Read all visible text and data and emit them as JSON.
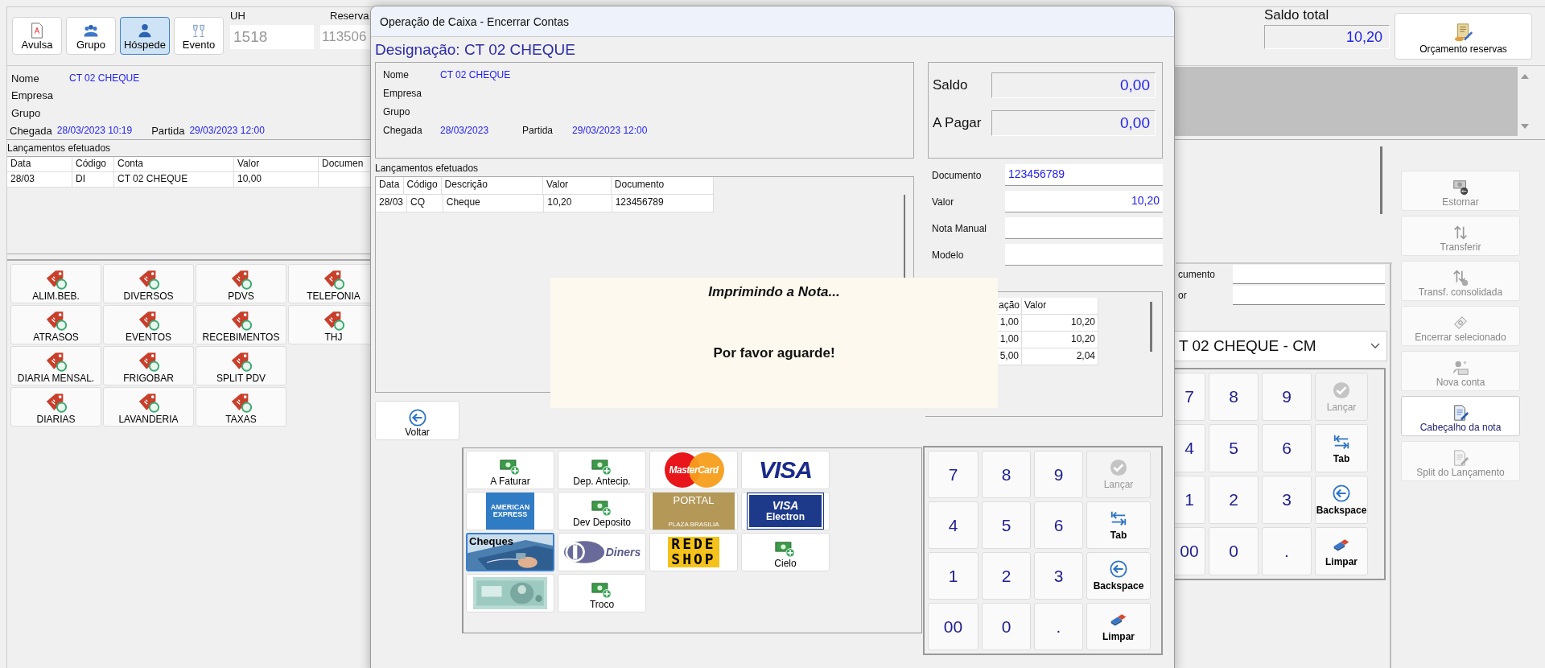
{
  "app": {
    "toolbar": [
      {
        "label": "Avulsa",
        "selected": false
      },
      {
        "label": "Grupo",
        "selected": false
      },
      {
        "label": "Hóspede",
        "selected": true
      },
      {
        "label": "Evento",
        "selected": false
      }
    ],
    "uh": {
      "label": "UH",
      "value": "1518"
    },
    "reserva": {
      "label": "Reserva",
      "value": "113506"
    },
    "saldo_total": {
      "label": "Saldo total",
      "value": "10,20"
    },
    "orcamento_button": "Orçamento reservas",
    "guest": {
      "nome_label": "Nome",
      "nome": "CT 02 CHEQUE",
      "empresa_label": "Empresa",
      "grupo_label": "Grupo",
      "chegada_label": "Chegada",
      "chegada": "28/03/2023 10:19",
      "partida_label": "Partida",
      "partida": "29/03/2023 12:00"
    },
    "lancamentos": {
      "title": "Lançamentos efetuados",
      "columns": [
        "Data",
        "Código",
        "Conta",
        "Valor",
        "Documen"
      ],
      "rows": [
        [
          "28/03",
          "DI",
          "CT 02 CHEQUE",
          "10,00"
        ]
      ]
    },
    "categories": [
      [
        "ALIM.BEB.",
        "DIVERSOS",
        "PDVS",
        "TELEFONIA"
      ],
      [
        "ATRASOS",
        "EVENTOS",
        "RECEBIMENTOS",
        "THJ"
      ],
      [
        "DIARIA MENSAL.",
        "FRIGOBAR",
        "SPLIT PDV"
      ],
      [
        "DIARIAS",
        "LAVANDERIA",
        "TAXAS"
      ]
    ],
    "side_fields": [
      {
        "label": "cumento"
      },
      {
        "label": "or"
      }
    ],
    "account_select": "T 02 CHEQUE - CM",
    "keypad": [
      {
        "label": "7",
        "kind": "digit",
        "disabled": false
      },
      {
        "label": "8",
        "kind": "digit",
        "disabled": false
      },
      {
        "label": "9",
        "kind": "digit",
        "disabled": false
      },
      {
        "label": "Lançar",
        "kind": "enter",
        "disabled": true
      },
      {
        "label": "4",
        "kind": "digit",
        "disabled": false
      },
      {
        "label": "5",
        "kind": "digit",
        "disabled": false
      },
      {
        "label": "6",
        "kind": "digit",
        "disabled": false
      },
      {
        "label": "Tab",
        "kind": "tab",
        "disabled": false
      },
      {
        "label": "1",
        "kind": "digit",
        "disabled": false
      },
      {
        "label": "2",
        "kind": "digit",
        "disabled": false
      },
      {
        "label": "3",
        "kind": "digit",
        "disabled": false
      },
      {
        "label": "Backspace",
        "kind": "backspace",
        "disabled": false
      },
      {
        "label": "00",
        "kind": "digit",
        "disabled": false
      },
      {
        "label": "0",
        "kind": "digit",
        "disabled": false
      },
      {
        "label": ".",
        "kind": "digit",
        "disabled": false
      },
      {
        "label": "Limpar",
        "kind": "clear",
        "disabled": false
      }
    ],
    "actions": [
      {
        "label": "Estornar",
        "disabled": true
      },
      {
        "label": "Transferir",
        "disabled": true
      },
      {
        "label": "Transf. consolidada",
        "disabled": true
      },
      {
        "label": "Encerrar selecionado",
        "disabled": true
      },
      {
        "label": "Nova conta",
        "disabled": true
      },
      {
        "label": "Cabeçalho da nota",
        "disabled": false
      },
      {
        "label": "Split do Lançamento",
        "disabled": true
      }
    ]
  },
  "dialog": {
    "title": "Operação de Caixa - Encerrar Contas",
    "designacao": "Designação: CT 02 CHEQUE",
    "info": {
      "nome_label": "Nome",
      "nome": "CT 02 CHEQUE",
      "empresa_label": "Empresa",
      "grupo_label": "Grupo",
      "chegada_label": "Chegada",
      "chegada": "28/03/2023",
      "partida_label": "Partida",
      "partida": "29/03/2023 12:00"
    },
    "saldo": {
      "label": "Saldo",
      "value": "0,00"
    },
    "a_pagar": {
      "label": "A Pagar",
      "value": "0,00"
    },
    "lancamentos": {
      "title": "Lançamentos efetuados",
      "columns": [
        "Data",
        "Código",
        "Descrição",
        "Valor",
        "Documento"
      ],
      "rows": [
        [
          "28/03",
          "CQ",
          "Cheque",
          "10,20",
          "123456789"
        ]
      ]
    },
    "fields": [
      {
        "label": "Documento",
        "value": "123456789"
      },
      {
        "label": "Valor",
        "value": "10,20"
      },
      {
        "label": "Nota Manual"
      },
      {
        "label": "Modelo"
      }
    ],
    "small_table": {
      "columns": [
        "ação",
        "Valor"
      ],
      "rows": [
        [
          "1,00",
          "10,20"
        ],
        [
          "1,00",
          "10,20"
        ],
        [
          "5,00",
          "2,04"
        ]
      ]
    },
    "voltar": "Voltar",
    "payments": [
      {
        "kind": "cash",
        "label": "A Faturar",
        "selected": false
      },
      {
        "kind": "cash",
        "label": "Dep. Antecip.",
        "selected": false
      },
      {
        "kind": "mastercard",
        "text": [
          "MasterCard"
        ],
        "selected": false
      },
      {
        "kind": "visa",
        "text": [
          "VISA"
        ],
        "selected": false
      },
      {
        "kind": "amex",
        "text": [
          "AMERICAN",
          "EXPRESS"
        ],
        "selected": false
      },
      {
        "kind": "cash",
        "label": "Dev Deposito",
        "selected": false
      },
      {
        "kind": "portal",
        "text": [
          "PORTAL",
          "PLAZA BRASILIA"
        ],
        "selected": false
      },
      {
        "kind": "visa-electron",
        "text": [
          "VISA",
          "Electron"
        ],
        "selected": false
      },
      {
        "kind": "cheques",
        "label": "Cheques",
        "selected": true
      },
      {
        "kind": "diners",
        "text": [
          "Diners"
        ],
        "selected": false
      },
      {
        "kind": "redeshop",
        "text": [
          "REDE",
          "SHOP"
        ],
        "selected": false
      },
      {
        "kind": "cash",
        "label": "Cielo",
        "selected": false
      },
      {
        "kind": "banknote",
        "selected": false
      },
      {
        "kind": "cash",
        "label": "Troco",
        "selected": false
      }
    ],
    "keypad": [
      {
        "label": "7",
        "kind": "digit",
        "disabled": false
      },
      {
        "label": "8",
        "kind": "digit",
        "disabled": false
      },
      {
        "label": "9",
        "kind": "digit",
        "disabled": false
      },
      {
        "label": "Lançar",
        "kind": "enter",
        "disabled": true
      },
      {
        "label": "4",
        "kind": "digit",
        "disabled": false
      },
      {
        "label": "5",
        "kind": "digit",
        "disabled": false
      },
      {
        "label": "6",
        "kind": "digit",
        "disabled": false
      },
      {
        "label": "Tab",
        "kind": "tab",
        "disabled": false
      },
      {
        "label": "1",
        "kind": "digit",
        "disabled": false
      },
      {
        "label": "2",
        "kind": "digit",
        "disabled": false
      },
      {
        "label": "3",
        "kind": "digit",
        "disabled": false
      },
      {
        "label": "Backspace",
        "kind": "backspace",
        "disabled": false
      },
      {
        "label": "00",
        "kind": "digit",
        "disabled": false
      },
      {
        "label": "0",
        "kind": "digit",
        "disabled": false
      },
      {
        "label": ".",
        "kind": "digit",
        "disabled": false
      },
      {
        "label": "Limpar",
        "kind": "clear",
        "disabled": false
      }
    ],
    "loading": {
      "title": "Imprimindo a Nota...",
      "message": "Por favor aguarde!"
    }
  }
}
